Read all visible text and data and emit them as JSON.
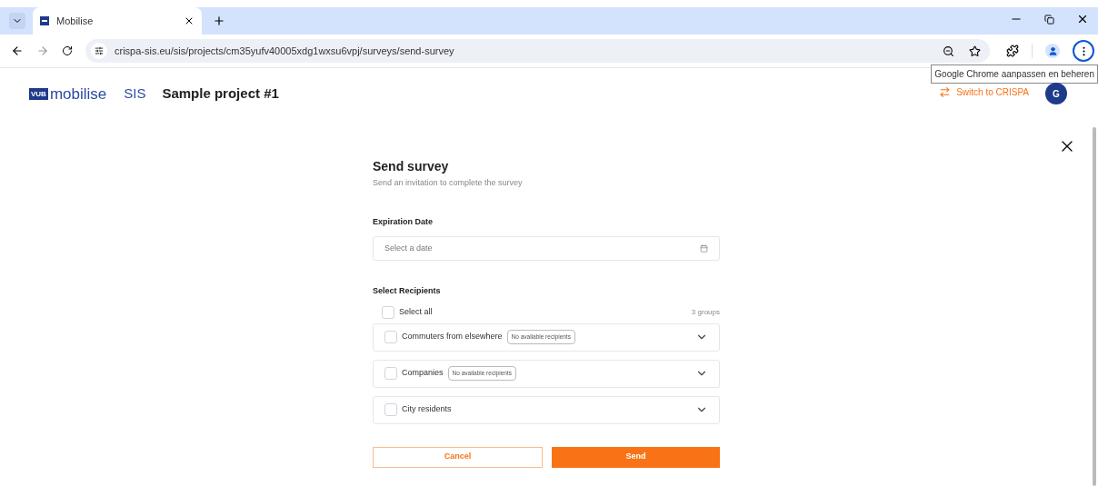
{
  "browser": {
    "tab": {
      "title": "Mobilise"
    },
    "url": "crispa-sis.eu/sis/projects/cm35yufv40005xdg1wxsu6vpj/surveys/send-survey",
    "tooltip": "Google Chrome aanpassen en beheren"
  },
  "header": {
    "logo_badge": "VUB",
    "logo_text": "mobilise",
    "app": "SIS",
    "project": "Sample project #1",
    "switch_link": "Switch to CRISPA",
    "avatar": "G"
  },
  "form": {
    "title": "Send survey",
    "subtitle": "Send an invitation to complete the survey",
    "date_label": "Expiration Date",
    "date_placeholder": "Select a date",
    "recipients_label": "Select Recipients",
    "select_all": {
      "label": "Select all",
      "checked": false
    },
    "count": "3 groups",
    "groups": [
      {
        "name": "Commuters from elsewhere",
        "badge": "No available recipients",
        "checked": false,
        "expanded": false
      },
      {
        "name": "Companies",
        "badge": "No available recipients",
        "checked": false,
        "expanded": false
      },
      {
        "name": "City residents",
        "checked": false,
        "expanded": false
      }
    ],
    "cancel": "Cancel",
    "send": "Send"
  }
}
